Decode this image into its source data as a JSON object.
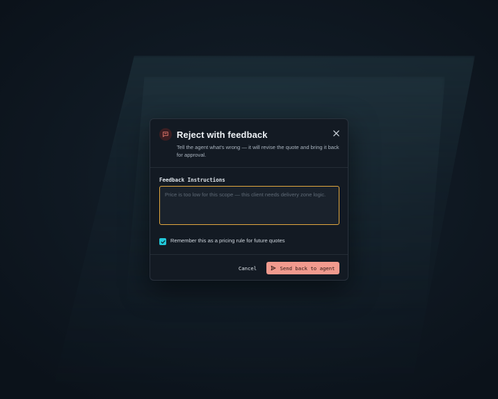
{
  "dialog": {
    "title": "Reject with feedback",
    "subtitle": "Tell the agent what's wrong — it will revise the quote and bring it back for approval.",
    "header_icon": "message-square-icon",
    "close_icon": "close-icon"
  },
  "feedback": {
    "label": "Feedback Instructions",
    "value": "",
    "placeholder": "Price is too low for this scope — this client needs delivery zone logic."
  },
  "remember": {
    "label": "Remember this as a pricing rule for future quotes",
    "checked": true
  },
  "footer": {
    "cancel_label": "Cancel",
    "send_label": "Send back to agent",
    "send_icon": "send-icon"
  },
  "colors": {
    "accent_focus": "#e3a83f",
    "checkbox": "#22c8da",
    "primary_button": "#f19a8e",
    "icon_red": "#e87a6e"
  }
}
